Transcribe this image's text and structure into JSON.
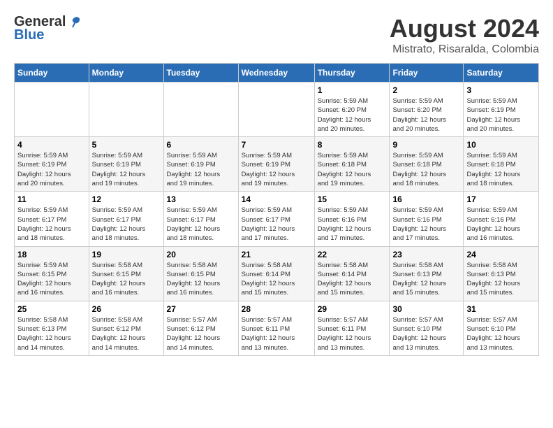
{
  "header": {
    "logo_general": "General",
    "logo_blue": "Blue",
    "month_year": "August 2024",
    "location": "Mistrato, Risaralda, Colombia"
  },
  "days_of_week": [
    "Sunday",
    "Monday",
    "Tuesday",
    "Wednesday",
    "Thursday",
    "Friday",
    "Saturday"
  ],
  "weeks": [
    [
      {
        "day": "",
        "info": ""
      },
      {
        "day": "",
        "info": ""
      },
      {
        "day": "",
        "info": ""
      },
      {
        "day": "",
        "info": ""
      },
      {
        "day": "1",
        "info": "Sunrise: 5:59 AM\nSunset: 6:20 PM\nDaylight: 12 hours\nand 20 minutes."
      },
      {
        "day": "2",
        "info": "Sunrise: 5:59 AM\nSunset: 6:20 PM\nDaylight: 12 hours\nand 20 minutes."
      },
      {
        "day": "3",
        "info": "Sunrise: 5:59 AM\nSunset: 6:19 PM\nDaylight: 12 hours\nand 20 minutes."
      }
    ],
    [
      {
        "day": "4",
        "info": "Sunrise: 5:59 AM\nSunset: 6:19 PM\nDaylight: 12 hours\nand 20 minutes."
      },
      {
        "day": "5",
        "info": "Sunrise: 5:59 AM\nSunset: 6:19 PM\nDaylight: 12 hours\nand 19 minutes."
      },
      {
        "day": "6",
        "info": "Sunrise: 5:59 AM\nSunset: 6:19 PM\nDaylight: 12 hours\nand 19 minutes."
      },
      {
        "day": "7",
        "info": "Sunrise: 5:59 AM\nSunset: 6:19 PM\nDaylight: 12 hours\nand 19 minutes."
      },
      {
        "day": "8",
        "info": "Sunrise: 5:59 AM\nSunset: 6:18 PM\nDaylight: 12 hours\nand 19 minutes."
      },
      {
        "day": "9",
        "info": "Sunrise: 5:59 AM\nSunset: 6:18 PM\nDaylight: 12 hours\nand 18 minutes."
      },
      {
        "day": "10",
        "info": "Sunrise: 5:59 AM\nSunset: 6:18 PM\nDaylight: 12 hours\nand 18 minutes."
      }
    ],
    [
      {
        "day": "11",
        "info": "Sunrise: 5:59 AM\nSunset: 6:17 PM\nDaylight: 12 hours\nand 18 minutes."
      },
      {
        "day": "12",
        "info": "Sunrise: 5:59 AM\nSunset: 6:17 PM\nDaylight: 12 hours\nand 18 minutes."
      },
      {
        "day": "13",
        "info": "Sunrise: 5:59 AM\nSunset: 6:17 PM\nDaylight: 12 hours\nand 18 minutes."
      },
      {
        "day": "14",
        "info": "Sunrise: 5:59 AM\nSunset: 6:17 PM\nDaylight: 12 hours\nand 17 minutes."
      },
      {
        "day": "15",
        "info": "Sunrise: 5:59 AM\nSunset: 6:16 PM\nDaylight: 12 hours\nand 17 minutes."
      },
      {
        "day": "16",
        "info": "Sunrise: 5:59 AM\nSunset: 6:16 PM\nDaylight: 12 hours\nand 17 minutes."
      },
      {
        "day": "17",
        "info": "Sunrise: 5:59 AM\nSunset: 6:16 PM\nDaylight: 12 hours\nand 16 minutes."
      }
    ],
    [
      {
        "day": "18",
        "info": "Sunrise: 5:59 AM\nSunset: 6:15 PM\nDaylight: 12 hours\nand 16 minutes."
      },
      {
        "day": "19",
        "info": "Sunrise: 5:58 AM\nSunset: 6:15 PM\nDaylight: 12 hours\nand 16 minutes."
      },
      {
        "day": "20",
        "info": "Sunrise: 5:58 AM\nSunset: 6:15 PM\nDaylight: 12 hours\nand 16 minutes."
      },
      {
        "day": "21",
        "info": "Sunrise: 5:58 AM\nSunset: 6:14 PM\nDaylight: 12 hours\nand 15 minutes."
      },
      {
        "day": "22",
        "info": "Sunrise: 5:58 AM\nSunset: 6:14 PM\nDaylight: 12 hours\nand 15 minutes."
      },
      {
        "day": "23",
        "info": "Sunrise: 5:58 AM\nSunset: 6:13 PM\nDaylight: 12 hours\nand 15 minutes."
      },
      {
        "day": "24",
        "info": "Sunrise: 5:58 AM\nSunset: 6:13 PM\nDaylight: 12 hours\nand 15 minutes."
      }
    ],
    [
      {
        "day": "25",
        "info": "Sunrise: 5:58 AM\nSunset: 6:13 PM\nDaylight: 12 hours\nand 14 minutes."
      },
      {
        "day": "26",
        "info": "Sunrise: 5:58 AM\nSunset: 6:12 PM\nDaylight: 12 hours\nand 14 minutes."
      },
      {
        "day": "27",
        "info": "Sunrise: 5:57 AM\nSunset: 6:12 PM\nDaylight: 12 hours\nand 14 minutes."
      },
      {
        "day": "28",
        "info": "Sunrise: 5:57 AM\nSunset: 6:11 PM\nDaylight: 12 hours\nand 13 minutes."
      },
      {
        "day": "29",
        "info": "Sunrise: 5:57 AM\nSunset: 6:11 PM\nDaylight: 12 hours\nand 13 minutes."
      },
      {
        "day": "30",
        "info": "Sunrise: 5:57 AM\nSunset: 6:10 PM\nDaylight: 12 hours\nand 13 minutes."
      },
      {
        "day": "31",
        "info": "Sunrise: 5:57 AM\nSunset: 6:10 PM\nDaylight: 12 hours\nand 13 minutes."
      }
    ]
  ]
}
